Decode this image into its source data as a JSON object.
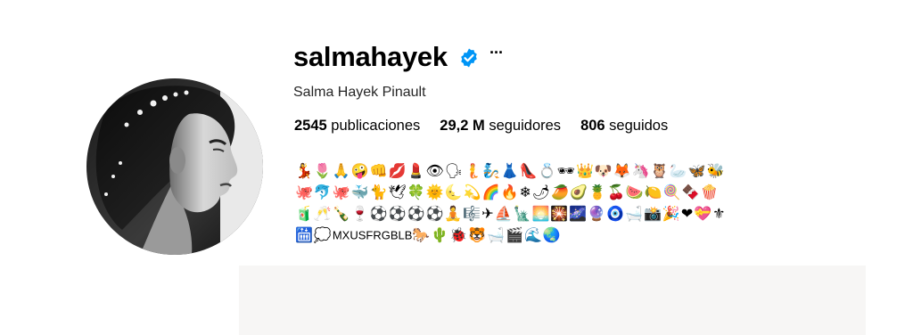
{
  "profile": {
    "username": "salmahayek",
    "verified_icon": "verified-badge-icon",
    "more_icon": "more-options-icon",
    "more_label": "···",
    "full_name": "Salma Hayek Pinault",
    "avatar_icon": "profile-photo"
  },
  "stats": {
    "posts_count": "2545",
    "posts_label": " publicaciones",
    "followers_count": "29,2 M",
    "followers_label": " seguidores",
    "following_count": "806",
    "following_label": " seguidos"
  },
  "bio": {
    "line1": "💃🌷🙏🤪👊💋💄👁🗣🧜🧞👗👠💍🕶👑🐶🦊🦄🦉🦢🦋🐝",
    "line2": "🐙🐬🐙🐳🐈🕊🍀🌞🌜💫🌈🔥❄🌶🥭🥑🍍🍒🍉🍋🍭🍫🍿",
    "line3": "🧃🥂🍾🍷⚽⚽⚽⚽🧘🎼✈⛵🗽🌅🎇🌌🔮🧿🛁📸🎉❤💝⚜",
    "line4_start": "🛗💭",
    "line4_text": "MXUSFRGBLB",
    "line4_end": "🐎🌵🐞🐯🛁🎬🌊🌏"
  },
  "colors": {
    "verified_blue": "#0095f6",
    "panel_grey": "#f7f6f5"
  }
}
